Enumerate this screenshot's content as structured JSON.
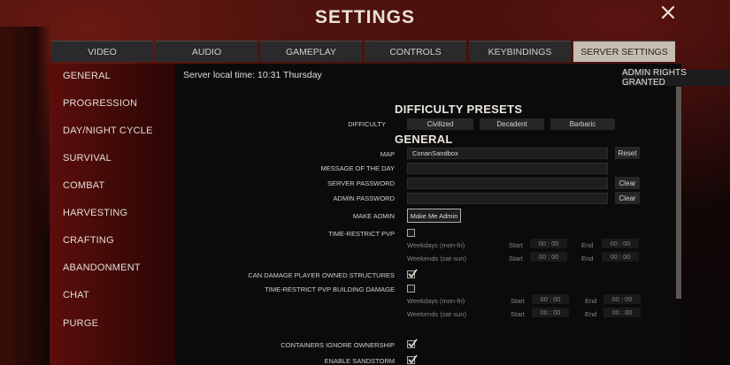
{
  "window": {
    "title": "SETTINGS"
  },
  "tabs": [
    {
      "label": "VIDEO"
    },
    {
      "label": "AUDIO"
    },
    {
      "label": "GAMEPLAY"
    },
    {
      "label": "CONTROLS"
    },
    {
      "label": "KEYBINDINGS"
    },
    {
      "label": "SERVER SETTINGS",
      "active": true
    }
  ],
  "sidebar": {
    "items": [
      {
        "label": "GENERAL"
      },
      {
        "label": "PROGRESSION"
      },
      {
        "label": "DAY/NIGHT CYCLE"
      },
      {
        "label": "SURVIVAL"
      },
      {
        "label": "COMBAT"
      },
      {
        "label": "HARVESTING"
      },
      {
        "label": "CRAFTING"
      },
      {
        "label": "ABANDONMENT"
      },
      {
        "label": "CHAT"
      },
      {
        "label": "PURGE"
      }
    ]
  },
  "header": {
    "server_time": "Server local time: 10:31  Thursday",
    "admin_badge": "ADMIN RIGHTS GRANTED"
  },
  "difficulty": {
    "heading": "DIFFICULTY PRESETS",
    "label": "DIFFICULTY",
    "options": [
      "Civilized",
      "Decadent",
      "Barbaric"
    ]
  },
  "general": {
    "heading": "GENERAL",
    "map_label": "MAP",
    "map_value": "ConanSandbox",
    "reset_label": "Reset",
    "motd_label": "MESSAGE OF THE DAY",
    "motd_value": "",
    "server_password_label": "SERVER PASSWORD",
    "admin_password_label": "ADMIN PASSWORD",
    "clear_label": "Clear",
    "make_admin_label": "MAKE ADMIN",
    "make_admin_button": "Make Me Admin",
    "time_restrict_pvp_label": "TIME-RESTRICT PVP",
    "time_restrict_pvp_checked": false,
    "weekdays_label": "Weekdays (mon-fri)",
    "weekends_label": "Weekends (sat-sun)",
    "start_label": "Start",
    "end_label": "End",
    "time_placeholder": "00 : 00",
    "can_damage_label": "CAN DAMAGE PLAYER OWNED STRUCTURES",
    "can_damage_checked": true,
    "time_restrict_building_label": "TIME-RESTRICT PVP BUILDING DAMAGE",
    "time_restrict_building_checked": false,
    "containers_label": "CONTAINERS IGNORE OWNERSHIP",
    "containers_checked": true,
    "partial_label": "ENABLE SANDSTORM",
    "partial_checked": true
  },
  "colors": {
    "accent_red": "#5c0e0b",
    "active_tab": "#c4bdb0",
    "panel": "#0b0b0d"
  }
}
